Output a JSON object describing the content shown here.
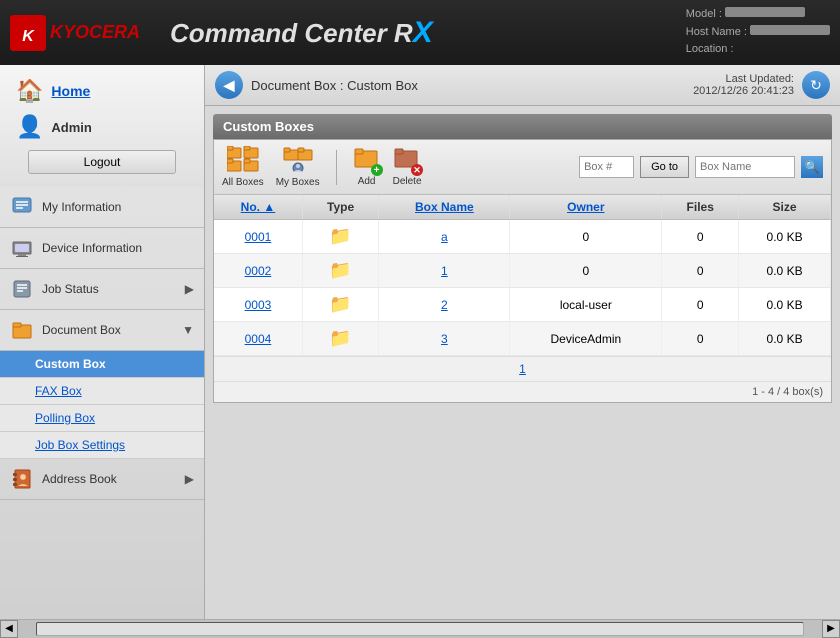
{
  "header": {
    "brand": "KYOCERA",
    "title": "Command Center R",
    "rx": "X",
    "model_label": "Model :",
    "model_value": "",
    "hostname_label": "Host Name :",
    "hostname_value": "",
    "location_label": "Location :",
    "location_value": ""
  },
  "sidebar": {
    "home_label": "Home",
    "admin_label": "Admin",
    "logout_label": "Logout",
    "nav_items": [
      {
        "id": "my-information",
        "label": "My Information",
        "icon": "person",
        "has_arrow": false
      },
      {
        "id": "device-information",
        "label": "Device Information",
        "icon": "printer",
        "has_arrow": false
      },
      {
        "id": "job-status",
        "label": "Job Status",
        "icon": "job",
        "has_arrow": true
      },
      {
        "id": "document-box",
        "label": "Document Box",
        "icon": "docbox",
        "has_arrow": true,
        "expanded": true
      }
    ],
    "document_box_sub": [
      {
        "id": "custom-box",
        "label": "Custom Box",
        "active": true
      },
      {
        "id": "fax-box",
        "label": "FAX Box",
        "active": false
      },
      {
        "id": "polling-box",
        "label": "Polling Box",
        "active": false
      },
      {
        "id": "job-box-settings",
        "label": "Job Box Settings",
        "active": false
      }
    ],
    "address_book": {
      "id": "address-book",
      "label": "Address Book",
      "icon": "addrbook",
      "has_arrow": true
    }
  },
  "breadcrumb": {
    "back_label": "◀",
    "text": "Document Box : Custom Box",
    "last_updated_label": "Last Updated:",
    "last_updated_value": "2012/12/26 20:41:23",
    "refresh_label": "↻"
  },
  "content": {
    "section_title": "Custom Boxes",
    "toolbar": {
      "all_boxes_label": "All Boxes",
      "my_boxes_label": "My Boxes",
      "add_label": "Add",
      "delete_label": "Delete",
      "box_num_placeholder": "Box #",
      "goto_label": "Go to",
      "box_name_placeholder": "Box Name"
    },
    "table": {
      "columns": [
        {
          "id": "no",
          "label": "No.",
          "sortable": true,
          "sort": "asc"
        },
        {
          "id": "type",
          "label": "Type",
          "sortable": false
        },
        {
          "id": "box_name",
          "label": "Box Name",
          "sortable": true
        },
        {
          "id": "owner",
          "label": "Owner",
          "sortable": true
        },
        {
          "id": "files",
          "label": "Files",
          "sortable": false
        },
        {
          "id": "size",
          "label": "Size",
          "sortable": false
        }
      ],
      "rows": [
        {
          "no": "0001",
          "type": "folder",
          "box_name": "a",
          "owner": "0",
          "files": "0",
          "size": "0.0 KB"
        },
        {
          "no": "0002",
          "type": "folder",
          "box_name": "1",
          "owner": "0",
          "files": "0",
          "size": "0.0 KB"
        },
        {
          "no": "0003",
          "type": "folder",
          "box_name": "2",
          "owner": "local-user",
          "files": "0",
          "size": "0.0 KB"
        },
        {
          "no": "0004",
          "type": "folder",
          "box_name": "3",
          "owner": "DeviceAdmin",
          "files": "0",
          "size": "0.0 KB"
        }
      ]
    },
    "pagination": {
      "current_page": "1"
    },
    "total_info": "1 - 4 / 4 box(s)"
  }
}
